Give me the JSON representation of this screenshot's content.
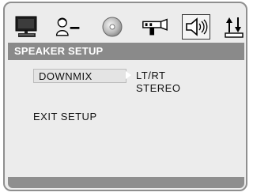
{
  "toolbar": {
    "icons": [
      {
        "name": "general-setup-monitor-icon",
        "active": false
      },
      {
        "name": "preference-user-icon",
        "active": false
      },
      {
        "name": "disc-icon",
        "active": false
      },
      {
        "name": "video-camera-icon",
        "active": false
      },
      {
        "name": "speaker-icon",
        "active": true
      },
      {
        "name": "sort-arrows-icon",
        "active": false
      }
    ]
  },
  "header": {
    "title": "SPEAKER SETUP"
  },
  "menu": {
    "items": [
      {
        "label": "DOWNMIX",
        "selected": true
      },
      {
        "label": "EXIT SETUP",
        "selected": false
      }
    ],
    "options": [
      {
        "label": "LT/RT"
      },
      {
        "label": "STEREO"
      }
    ]
  },
  "colors": {
    "panel_bg": "#ececec",
    "header_bg": "#8a8a8a",
    "header_text": "#ffffff",
    "bottom_bar": "#8e8e8e"
  }
}
